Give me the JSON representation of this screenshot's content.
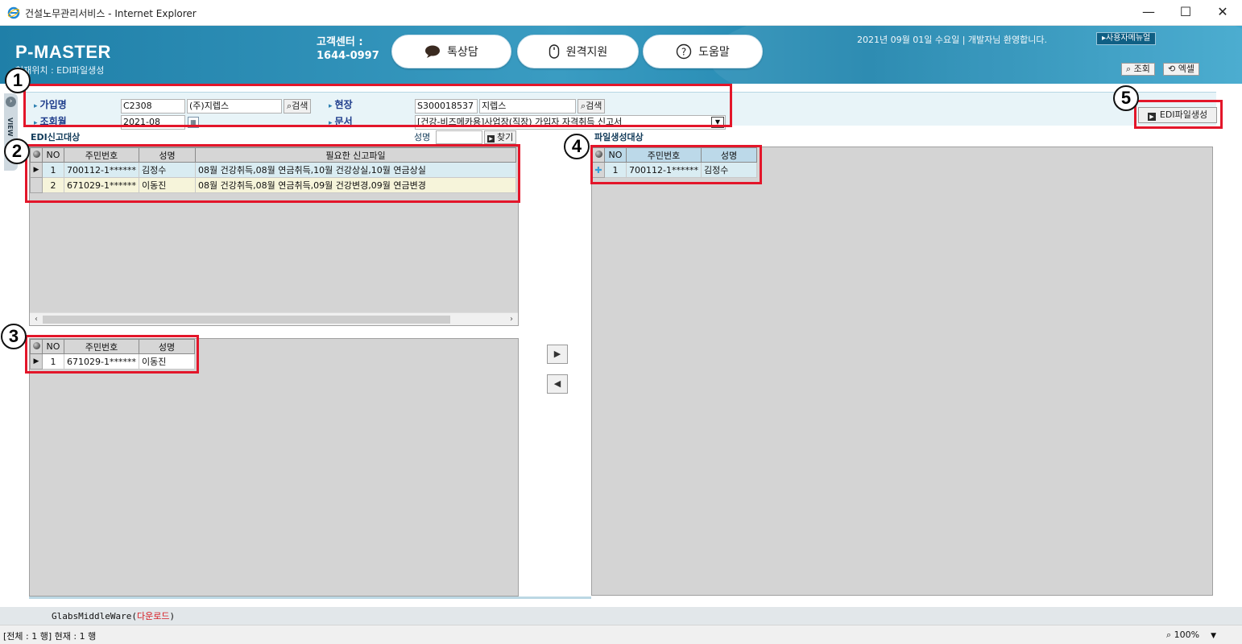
{
  "window": {
    "title": "건설노무관리서비스 - Internet Explorer",
    "minimize": "—",
    "maximize": "☐",
    "close": "✕"
  },
  "header": {
    "brand": "P-MASTER",
    "location": "현재위치 : EDI파일생성",
    "cs_label": "고객센터 :",
    "cs_phone": "1644-0997",
    "chat_button": "톡상담",
    "remote_button": "원격지원",
    "help_button": "도움말",
    "welcome": "2021년 09월 01일 수요일 | 개발자님 환영합니다.",
    "manual_button": "▸사용자메뉴얼",
    "query_button": "조회",
    "excel_button": "엑셀"
  },
  "sidebar": {
    "tab_label": "VIEW"
  },
  "search": {
    "company_label": "가입명",
    "company_code": "C2308",
    "company_name": "(주)지렙스",
    "company_search": "검색",
    "site_label": "현장",
    "site_code": "S300018537",
    "site_name": "지렙스",
    "site_search": "검색",
    "month_label": "조회월",
    "month_value": "2021-08",
    "doc_label": "문서",
    "doc_value": "[건강-비즈메카용]사업장(직장) 가입자 자격취득 신고서",
    "edi_button": "EDI파일생성"
  },
  "edi_targets": {
    "title": "EDI신고대상",
    "name_filter_label": "성명",
    "name_filter_value": "",
    "find_button": "찾기",
    "columns": {
      "no": "NO",
      "rrn": "주민번호",
      "name": "성명",
      "files": "필요한 신고파일"
    },
    "rows": [
      {
        "no": "1",
        "rrn": "700112-1******",
        "name": "김정수",
        "files": "08월 건강취득,08월 연금취득,10월 건강상실,10월 연금상실"
      },
      {
        "no": "2",
        "rrn": "671029-1******",
        "name": "이동진",
        "files": "08월 건강취득,08월 연금취득,09월 건강변경,09월 연금변경"
      }
    ]
  },
  "detail_grid": {
    "columns": {
      "no": "NO",
      "rrn": "주민번호",
      "name": "성명"
    },
    "rows": [
      {
        "no": "1",
        "rrn": "671029-1******",
        "name": "이동진"
      }
    ]
  },
  "file_targets": {
    "title": "파일생성대상",
    "columns": {
      "no": "NO",
      "rrn": "주민번호",
      "name": "성명"
    },
    "rows": [
      {
        "no": "1",
        "rrn": "700112-1******",
        "name": "김정수"
      }
    ]
  },
  "annotations": {
    "b1": "1",
    "b2": "2",
    "b3": "3",
    "b4": "4",
    "b5": "5"
  },
  "footer": {
    "middleware": "GlabsMiddleWare(",
    "download": "다운로드",
    "middleware_end": ")",
    "status": "[전체 : 1 행] 현재 : 1 행",
    "zoom": "100%"
  },
  "colors": {
    "header_blue": "#2a8fb8",
    "annotation_red": "#e3162a",
    "label_blue": "#1c3a8a"
  }
}
